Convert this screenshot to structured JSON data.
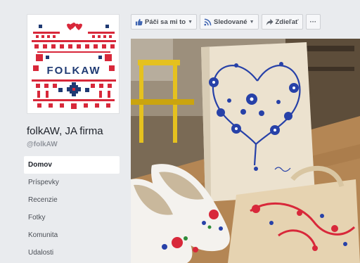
{
  "page": {
    "name": "folkAW, JA firma",
    "handle": "@folkAW",
    "logo_text": "FOLKAW"
  },
  "nav": {
    "items": [
      {
        "label": "Domov",
        "active": true
      },
      {
        "label": "Príspevky",
        "active": false
      },
      {
        "label": "Recenzie",
        "active": false
      },
      {
        "label": "Fotky",
        "active": false
      },
      {
        "label": "Komunita",
        "active": false
      },
      {
        "label": "Udalosti",
        "active": false
      }
    ]
  },
  "actions": {
    "like_label": "Páči sa mi to",
    "follow_label": "Sledované",
    "share_label": "Zdieľať",
    "more_label": "···"
  },
  "colors": {
    "like_blue": "#4267b2",
    "embroidery_red": "#d8283a",
    "embroidery_navy": "#1f3a73",
    "print_blue": "#2741a8"
  },
  "icons": {
    "like": "thumbs-up-icon",
    "follow": "rss-icon",
    "share": "share-arrow-icon",
    "more": "ellipsis-icon"
  }
}
